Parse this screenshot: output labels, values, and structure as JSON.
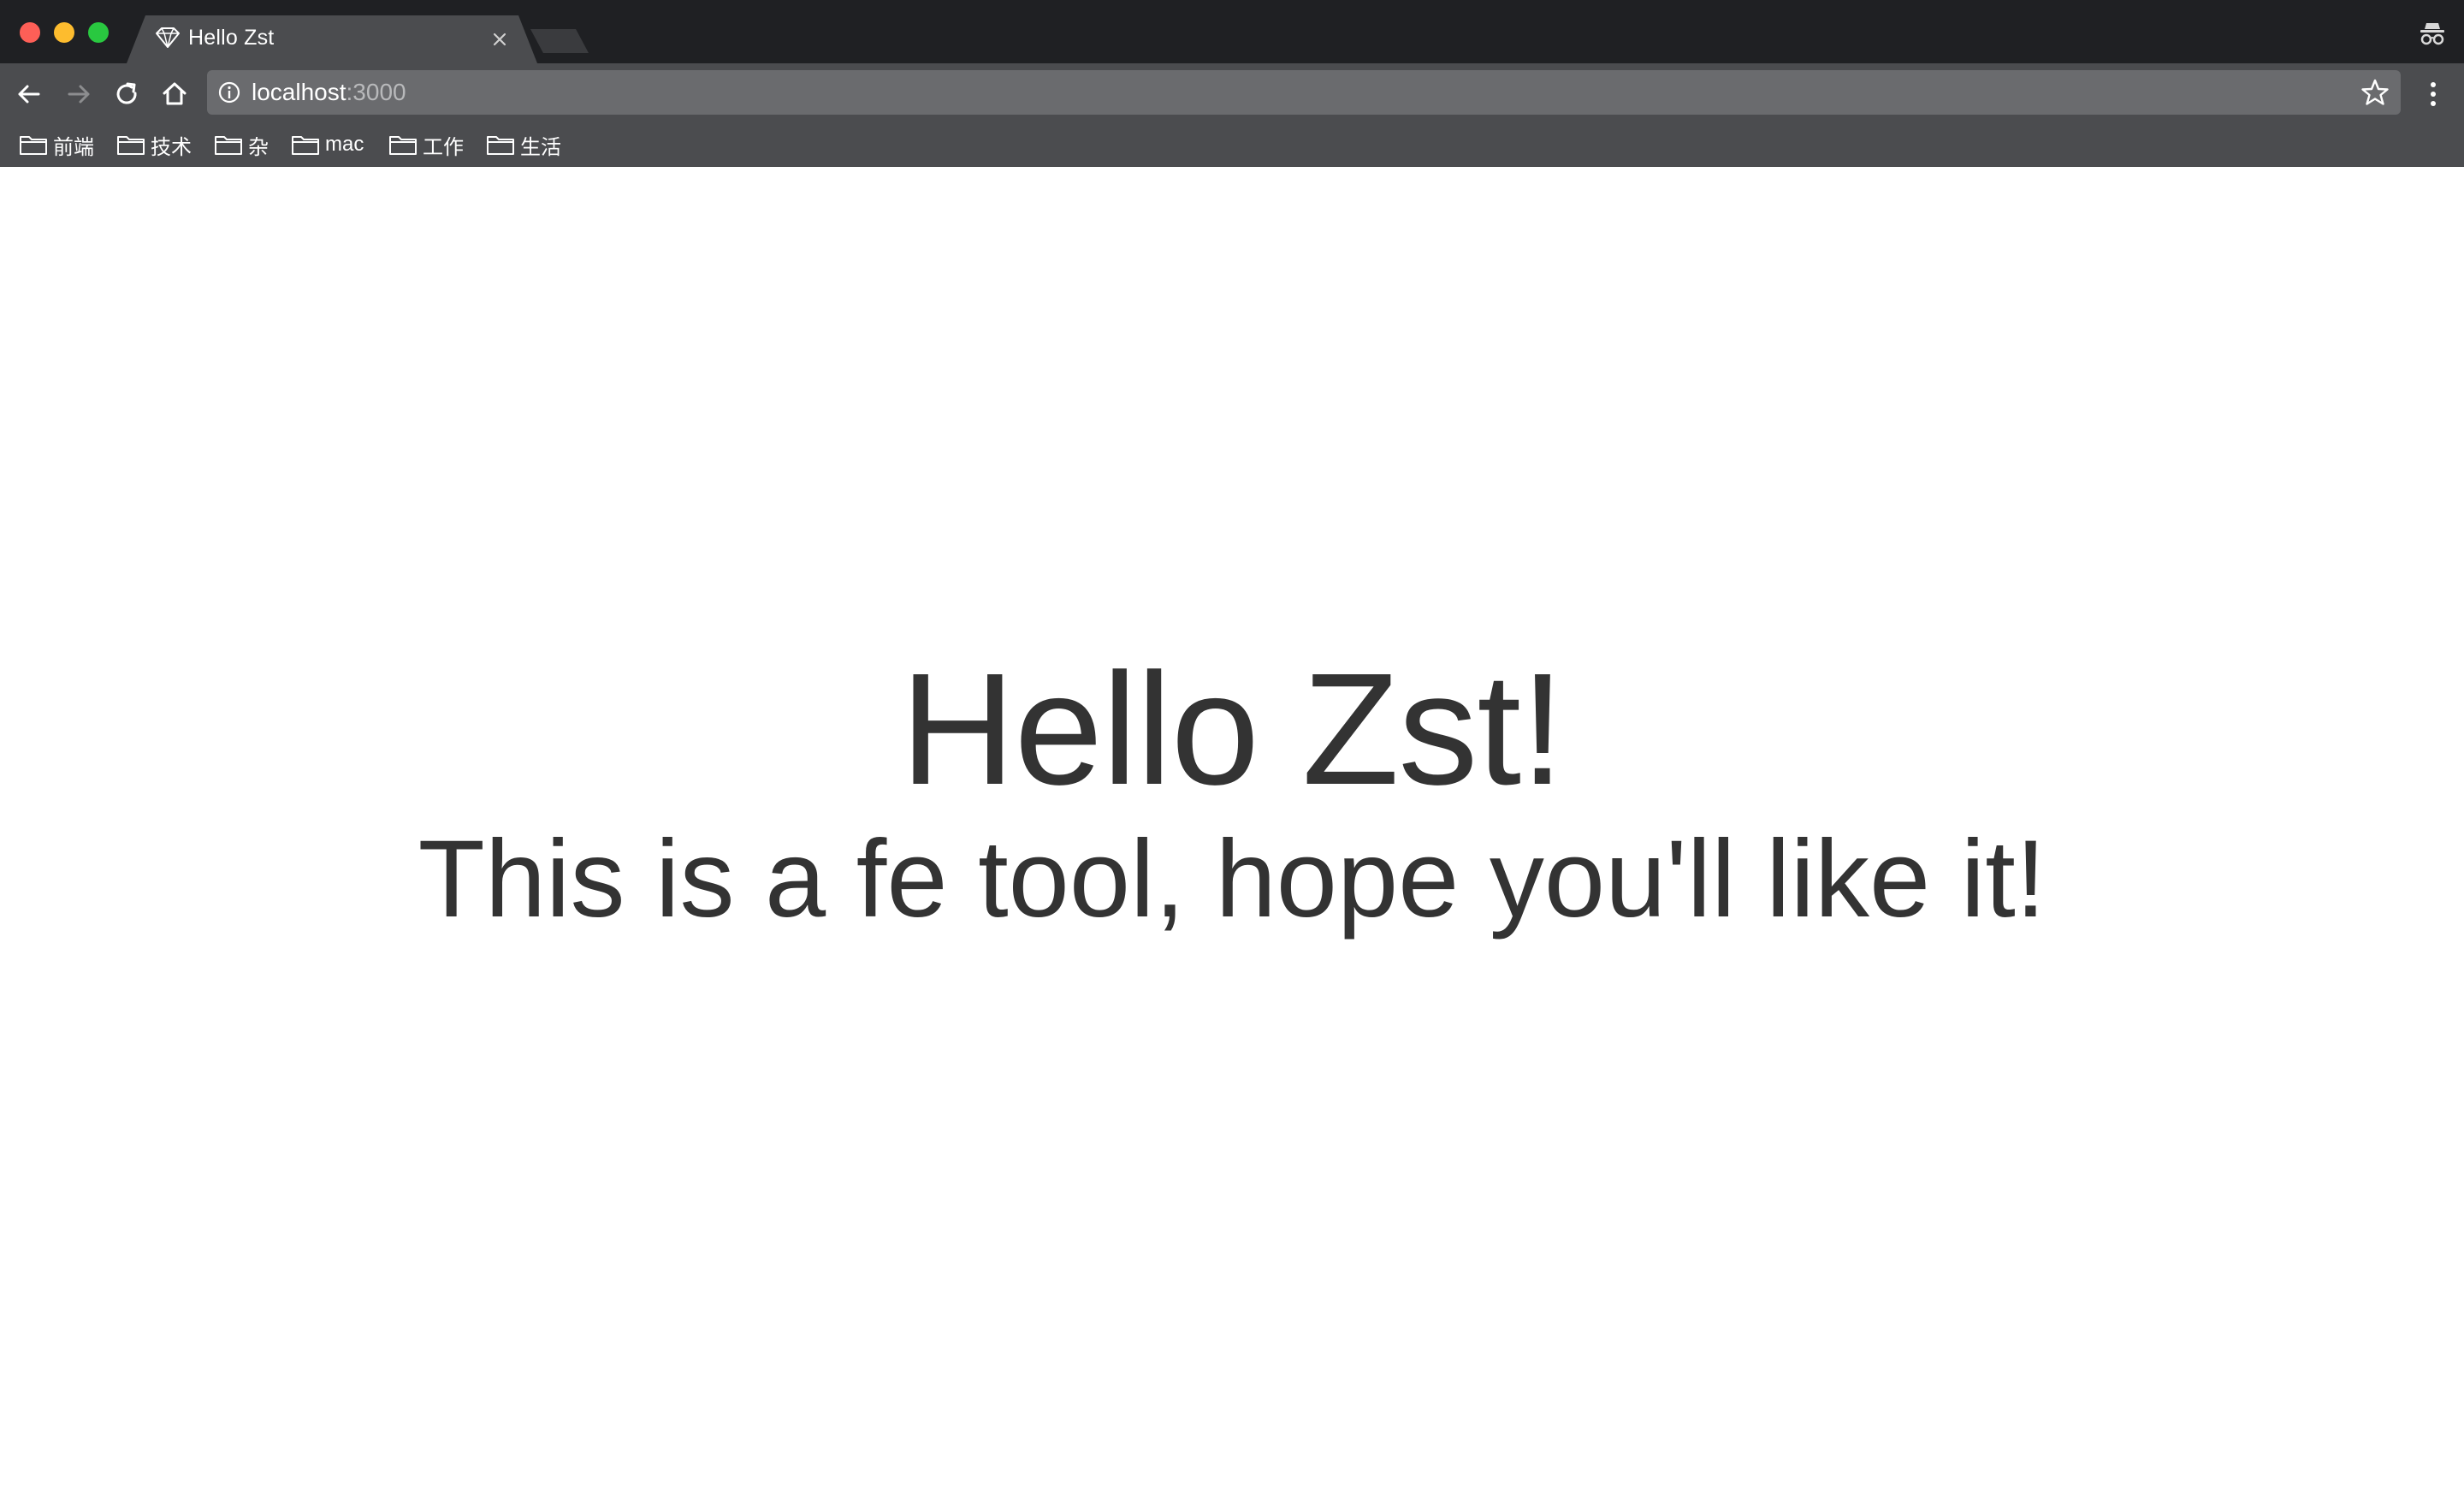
{
  "window": {
    "active_tab": {
      "title": "Hello Zst",
      "favicon": "diamond-icon"
    }
  },
  "toolbar": {
    "url_host": "localhost",
    "url_port": ":3000"
  },
  "bookmarks": [
    {
      "label": "前端",
      "icon": "folder-icon"
    },
    {
      "label": "技术",
      "icon": "folder-icon"
    },
    {
      "label": "杂",
      "icon": "folder-icon"
    },
    {
      "label": "mac",
      "icon": "folder-icon"
    },
    {
      "label": "工作",
      "icon": "folder-icon"
    },
    {
      "label": "生活",
      "icon": "folder-icon"
    }
  ],
  "page": {
    "title": "Hello Zst!",
    "subtitle": "This is a fe tool, hope you'll like it!"
  },
  "colors": {
    "tabstrip_bg": "#1f2023",
    "toolbar_bg": "#4b4c4f",
    "omnibox_bg": "#6a6b6e",
    "page_text": "#333333"
  }
}
